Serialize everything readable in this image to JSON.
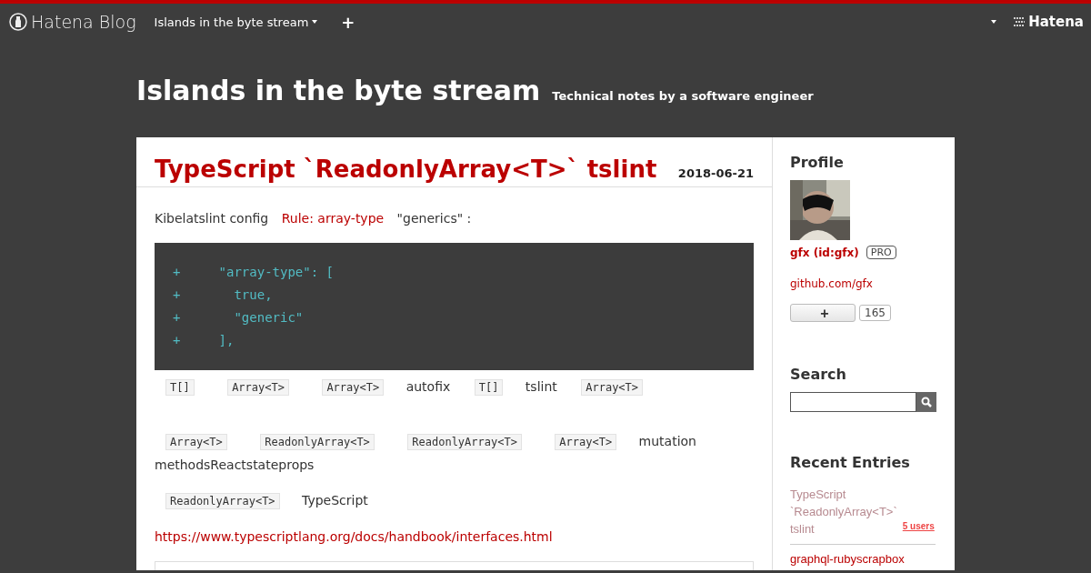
{
  "topbar": {
    "logo": "Hatena Blog",
    "blog_menu": "Islands in the byte stream",
    "add": "+",
    "brand": "Hatena"
  },
  "header": {
    "title": "Islands in the byte stream",
    "tagline": "Technical notes by a software engineer"
  },
  "article": {
    "title": "TypeScript `ReadonlyArray<T>` tslint",
    "date": "2018-06-21",
    "body": [
      {
        "kind": "para",
        "parts": [
          {
            "kind": "text",
            "text": "Kibelatslint config"
          },
          {
            "kind": "link",
            "text": "Rule: array-type"
          },
          {
            "kind": "text",
            "text": "\"generics\" :"
          }
        ]
      },
      {
        "kind": "code",
        "lines": [
          "+     \"array-type\": [",
          "+       true,",
          "+       \"generic\"",
          "+     ],"
        ]
      },
      {
        "kind": "para",
        "parts": [
          {
            "kind": "code",
            "text": "T[]"
          },
          {
            "kind": "code",
            "text": "Array<T>"
          },
          {
            "kind": "code",
            "text": "Array<T>"
          },
          {
            "kind": "text",
            "text": "autofix"
          },
          {
            "kind": "code",
            "text": "T[]"
          },
          {
            "kind": "text",
            "text": "tslint"
          },
          {
            "kind": "code",
            "text": "Array<T>"
          }
        ]
      },
      {
        "kind": "para",
        "parts": [
          {
            "kind": "code",
            "text": "Array<T>"
          },
          {
            "kind": "code",
            "text": "ReadonlyArray<T>"
          },
          {
            "kind": "code",
            "text": "ReadonlyArray<T>"
          },
          {
            "kind": "code",
            "text": "Array<T>"
          },
          {
            "kind": "text",
            "text": "mutation"
          },
          {
            "kind": "text",
            "text": "methodsReactstateprops"
          }
        ]
      },
      {
        "kind": "para",
        "parts": [
          {
            "kind": "code",
            "text": "ReadonlyArray<T>"
          },
          {
            "kind": "text",
            "text": "TypeScript"
          }
        ]
      },
      {
        "kind": "para",
        "parts": [
          {
            "kind": "link",
            "text": "https://www.typescriptlang.org/docs/handbook/interfaces.html"
          }
        ]
      },
      {
        "kind": "embed"
      }
    ]
  },
  "sidebar": {
    "profile": {
      "heading": "Profile",
      "name": "gfx (id:gfx)",
      "badge": "PRO",
      "link": "github.com/gfx",
      "follow": "+",
      "followers": "165"
    },
    "search": {
      "heading": "Search"
    },
    "recent": {
      "heading": "Recent Entries",
      "entries": [
        {
          "title": "TypeScript `ReadonlyArray<T>` tslint",
          "visited": true,
          "bookmarks": "5 users"
        },
        {
          "title": "graphql-rubyscrapbox",
          "visited": false
        }
      ]
    }
  }
}
